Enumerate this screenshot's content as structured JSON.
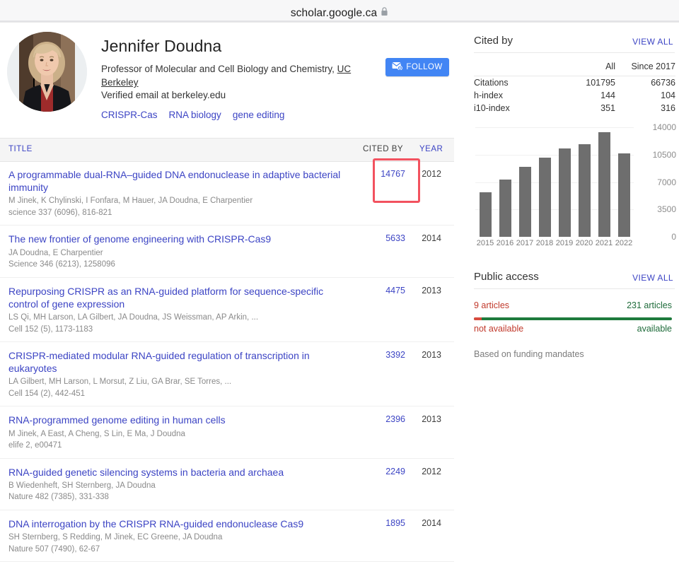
{
  "browser": {
    "url": "scholar.google.ca",
    "lock_icon": "lock-icon",
    "status_left": "",
    "status_right": ""
  },
  "profile": {
    "name": "Jennifer Doudna",
    "affiliation_prefix": "Professor of Molecular and Cell Biology and Chemistry, ",
    "affiliation_institution": "UC Berkeley",
    "verified_email": "Verified email at berkeley.edu",
    "interests": [
      "CRISPR-Cas",
      "RNA biology",
      "gene editing"
    ],
    "follow_label": "FOLLOW",
    "follow_icon": "envelope-add-icon",
    "avatar": "avatar"
  },
  "publications": {
    "headers": {
      "title": "TITLE",
      "cited_by": "CITED BY",
      "year": "YEAR"
    },
    "rows": [
      {
        "title": "A programmable dual-RNA–guided DNA endonuclease in adaptive bacterial immunity",
        "authors": "M Jinek, K Chylinski, I Fonfara, M Hauer, JA Doudna, E Charpentier",
        "venue": "science 337 (6096), 816-821",
        "cited_by": "14767",
        "year": "2012"
      },
      {
        "title": "The new frontier of genome engineering with CRISPR-Cas9",
        "authors": "JA Doudna, E Charpentier",
        "venue": "Science 346 (6213), 1258096",
        "cited_by": "5633",
        "year": "2014"
      },
      {
        "title": "Repurposing CRISPR as an RNA-guided platform for sequence-specific control of gene expression",
        "authors": "LS Qi, MH Larson, LA Gilbert, JA Doudna, JS Weissman, AP Arkin, ...",
        "venue": "Cell 152 (5), 1173-1183",
        "cited_by": "4475",
        "year": "2013"
      },
      {
        "title": "CRISPR-mediated modular RNA-guided regulation of transcription in eukaryotes",
        "authors": "LA Gilbert, MH Larson, L Morsut, Z Liu, GA Brar, SE Torres, ...",
        "venue": "Cell 154 (2), 442-451",
        "cited_by": "3392",
        "year": "2013"
      },
      {
        "title": "RNA-programmed genome editing in human cells",
        "authors": "M Jinek, A East, A Cheng, S Lin, E Ma, J Doudna",
        "venue": "elife 2, e00471",
        "cited_by": "2396",
        "year": "2013"
      },
      {
        "title": "RNA-guided genetic silencing systems in bacteria and archaea",
        "authors": "B Wiedenheft, SH Sternberg, JA Doudna",
        "venue": "Nature 482 (7385), 331-338",
        "cited_by": "2249",
        "year": "2012"
      },
      {
        "title": "DNA interrogation by the CRISPR RNA-guided endonuclease Cas9",
        "authors": "SH Sternberg, S Redding, M Jinek, EC Greene, JA Doudna",
        "venue": "Nature 507 (7490), 62-67",
        "cited_by": "1895",
        "year": "2014"
      }
    ],
    "highlight": {
      "target_cited_by": "14767",
      "color": "#f2525f"
    }
  },
  "cited_by_panel": {
    "title": "Cited by",
    "view_all": "VIEW ALL",
    "columns": [
      "",
      "All",
      "Since 2017"
    ],
    "rows": [
      {
        "label": "Citations",
        "all": "101795",
        "since": "66736"
      },
      {
        "label": "h-index",
        "all": "144",
        "since": "104"
      },
      {
        "label": "i10-index",
        "all": "351",
        "since": "316"
      }
    ]
  },
  "public_access": {
    "title": "Public access",
    "view_all": "VIEW ALL",
    "not_available_count": "9 articles",
    "available_count": "231 articles",
    "not_available_label": "not available",
    "available_label": "available",
    "note": "Based on funding mandates",
    "not_available_color": "#c1392b",
    "available_color": "#1e6b3a",
    "not_available_fraction": 3.75
  },
  "chart_data": {
    "type": "bar",
    "title": "",
    "xlabel": "",
    "ylabel": "",
    "categories": [
      "2015",
      "2016",
      "2017",
      "2018",
      "2019",
      "2020",
      "2021",
      "2022"
    ],
    "values": [
      5650,
      7350,
      8900,
      10150,
      11250,
      11850,
      13400,
      10650
    ],
    "ylim": [
      0,
      14000
    ],
    "yticks": [
      14000,
      10500,
      7000,
      3500,
      0
    ],
    "grid": true,
    "legend": false,
    "bar_color": "#6e6e6e"
  }
}
